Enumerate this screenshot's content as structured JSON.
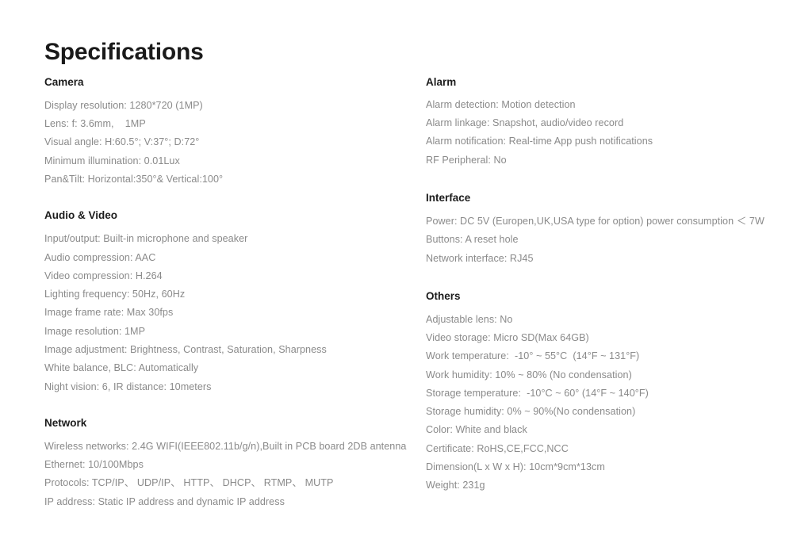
{
  "page": {
    "title": "Specifications"
  },
  "left_column": [
    {
      "heading": "Camera",
      "items": [
        "Display resolution: 1280*720 (1MP)",
        "Lens: f: 3.6mm,    1MP",
        "Visual angle: H:60.5°; V:37°; D:72°",
        "Minimum illumination: 0.01Lux",
        "Pan&Tilt: Horizontal:350°& Vertical:100°"
      ]
    },
    {
      "heading": "Audio & Video",
      "items": [
        "Input/output: Built-in microphone and speaker",
        "Audio compression: AAC",
        "Video compression: H.264",
        "Lighting frequency: 50Hz, 60Hz",
        "Image frame rate: Max 30fps",
        "Image resolution: 1MP",
        "Image adjustment: Brightness, Contrast, Saturation, Sharpness",
        "White balance, BLC: Automatically",
        "Night vision: 6, IR distance: 10meters"
      ]
    },
    {
      "heading": "Network",
      "items": [
        "Wireless networks: 2.4G WIFI(IEEE802.11b/g/n),Built in PCB board 2DB antenna",
        "Ethernet: 10/100Mbps",
        "Protocols: TCP/IP、 UDP/IP、 HTTP、 DHCP、 RTMP、 MUTP",
        "IP address: Static IP address and dynamic IP address"
      ]
    }
  ],
  "right_column": [
    {
      "heading": "Alarm",
      "items": [
        "Alarm detection: Motion detection",
        "Alarm linkage: Snapshot, audio/video record",
        "Alarm notification: Real-time App push notifications",
        "RF Peripheral: No"
      ]
    },
    {
      "heading": "Interface",
      "items": [
        "Power: DC 5V (Europen,UK,USA type for option) power consumption ＜ 7W",
        "Buttons: A reset hole",
        "Network interface: RJ45"
      ]
    },
    {
      "heading": "Others",
      "items": [
        "Adjustable lens: No",
        "Video storage: Micro SD(Max 64GB)",
        "Work temperature:  -10° ~ 55°C  (14°F ~ 131°F)",
        "Work humidity: 10% ~ 80% (No condensation)",
        "Storage temperature:  -10°C ~ 60° (14°F ~ 140°F)",
        "Storage humidity: 0% ~ 90%(No condensation)",
        "Color: White and black",
        "Certificate: RoHS,CE,FCC,NCC",
        "Dimension(L x W x H): 10cm*9cm*13cm",
        "Weight: 231g"
      ]
    }
  ],
  "colors": {
    "background": "#ffffff",
    "title": "#1a1a1a",
    "heading": "#1c1c1c",
    "body": "#8a8a8a"
  }
}
